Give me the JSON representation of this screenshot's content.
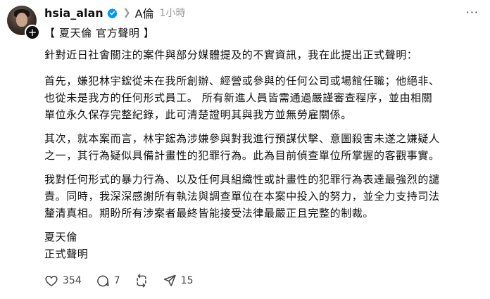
{
  "post": {
    "username": "hsia_alan",
    "topic": "A倫",
    "time": "1小時",
    "more": "···",
    "lines": [
      "【 夏天倫 官方聲明 】",
      "針對近日社會關注的案件與部分媒體提及的不實資訊，我在此提出正式聲明：",
      "首先，嫌犯林宇鋐從未在我所創辦、經營或參與的任何公司或場館任職；他絕非、",
      "也從未是我方的任何形式員工。 所有新進人員皆需通過嚴謹審查程序，並由相關",
      "單位永久保存完整紀錄，此可清楚證明其與我方並無勞雇關係。",
      "其次，就本案而言，林宇鋐為涉嫌參與對我進行預謀伏擊、意圖殺害未遂之嫌疑人",
      "之一，其行為疑似具備計畫性的犯罪行為。此為目前偵查單位所掌握的客觀事實。",
      "我對任何形式的暴力行為、以及任何具組織性或計畫性的犯罪行為表達最強烈的譴",
      "責。同時，我深深感謝所有執法與調查單位在本案中投入的努力，並全力支持司法",
      "釐清真相。期盼所有涉案者最終皆能接受法律最嚴正且完整的制裁。",
      "夏天倫",
      "正式聲明"
    ]
  },
  "actions": {
    "likes": "354",
    "comments": "7",
    "shares": "15"
  },
  "icons": {
    "avatar": "profile-photo",
    "follow": "plus-icon",
    "verified": "verified-badge-icon",
    "chevron": "chevron-right-icon",
    "like": "heart-icon",
    "comment": "comment-bubble-icon",
    "repost": "repost-icon",
    "share": "send-icon"
  },
  "colors": {
    "text": "#101010",
    "muted": "#999999",
    "verified": "#0095f6"
  }
}
